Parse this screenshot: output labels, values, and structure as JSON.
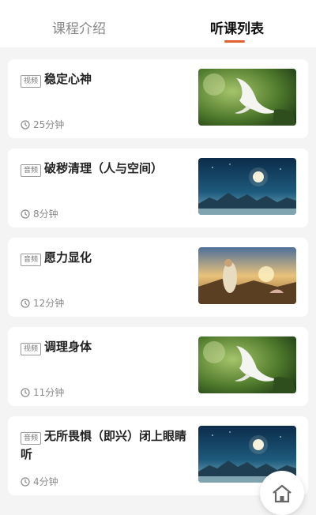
{
  "tabs": [
    {
      "label": "课程介绍",
      "active": false
    },
    {
      "label": "听课列表",
      "active": true
    }
  ],
  "accent_color": "#e0612f",
  "lessons": [
    {
      "badge": "视频",
      "title": "稳定心神",
      "duration": "25分钟",
      "thumbnail": "white-egret-green-forest"
    },
    {
      "badge": "音频",
      "title": "破秽清理（人与空间）",
      "duration": "8分钟",
      "thumbnail": "moonlit-night-mountains"
    },
    {
      "badge": "音频",
      "title": "愿力显化",
      "duration": "12分钟",
      "thumbnail": "woman-meditating-sunset"
    },
    {
      "badge": "视频",
      "title": "调理身体",
      "duration": "11分钟",
      "thumbnail": "white-egret-green-forest"
    },
    {
      "badge": "音频",
      "title": "无所畏惧（即兴）闭上眼睛听",
      "duration": "4分钟",
      "thumbnail": "moonlit-night-mountains"
    }
  ],
  "home_button": {
    "icon": "home-icon"
  }
}
